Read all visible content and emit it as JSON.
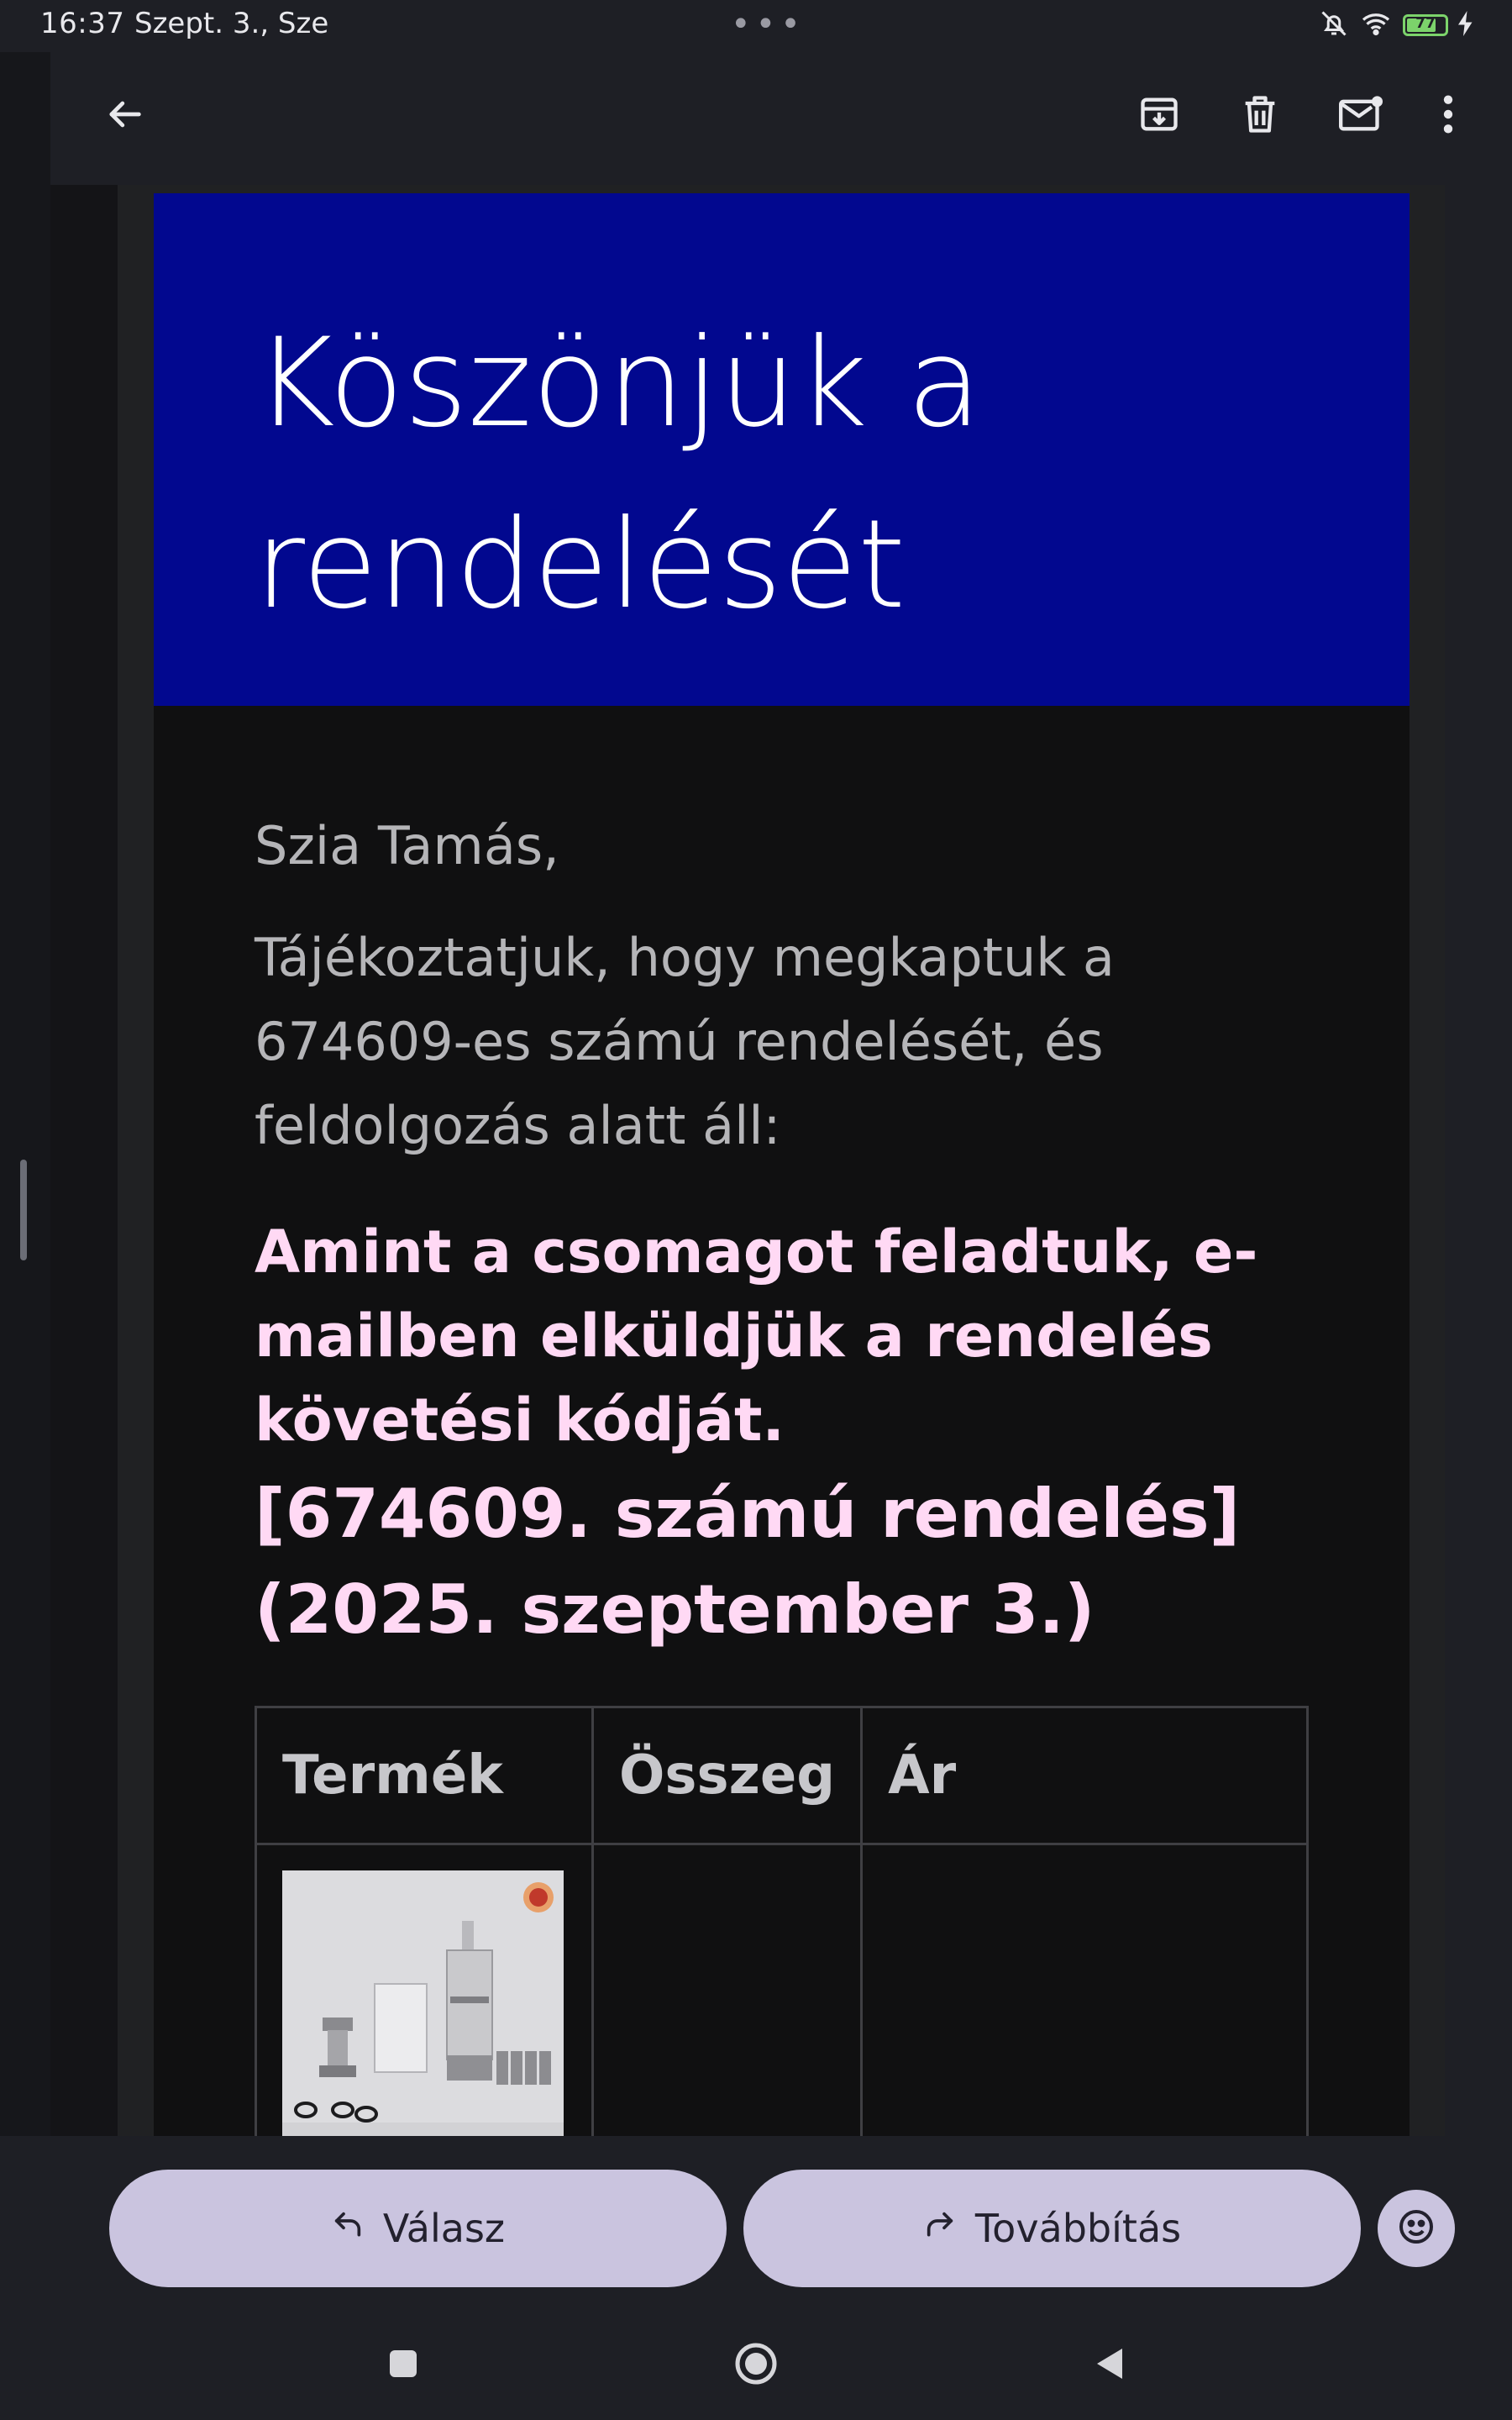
{
  "status_bar": {
    "time": "16:37",
    "date": "Szept. 3., Sze",
    "more_dots": "•••",
    "battery_level": "77",
    "battery_fraction": 0.77,
    "icons": [
      "bell-off-icon",
      "wifi-icon",
      "battery-icon",
      "charging-icon"
    ]
  },
  "app_bar": {
    "icons": [
      "back-arrow-icon",
      "archive-icon",
      "trash-icon",
      "mark-unread-icon",
      "more-vert-icon"
    ]
  },
  "email": {
    "hero_title": "Köszönjük a rendelését",
    "hero_color": "#02088f",
    "greeting": "Szia Tamás,",
    "intro": "Tájékoztatjuk, hogy megkaptuk a 674609-es számú rendelését, és feldolgozás alatt áll:",
    "notice": "Amint a csomagot feladtuk, e-mailben elküldjük a rendelés követési kódját.",
    "order_heading": "[674609. számú rendelés] (2025. szeptember 3.)",
    "accent_color": "#ffd9f4",
    "table": {
      "headers": [
        "Termék",
        "Összeg",
        "Ár"
      ],
      "rows": [
        {
          "product_image": "atomizer-product-photo",
          "amount": "",
          "price": ""
        }
      ]
    }
  },
  "actions": {
    "reply_label": "Válasz",
    "forward_label": "Továbbítás",
    "emoji_icon": "emoji-icon",
    "button_color": "#cac4df"
  },
  "nav_bar": {
    "icons": [
      "recents-square-icon",
      "home-circle-icon",
      "back-triangle-icon"
    ]
  }
}
